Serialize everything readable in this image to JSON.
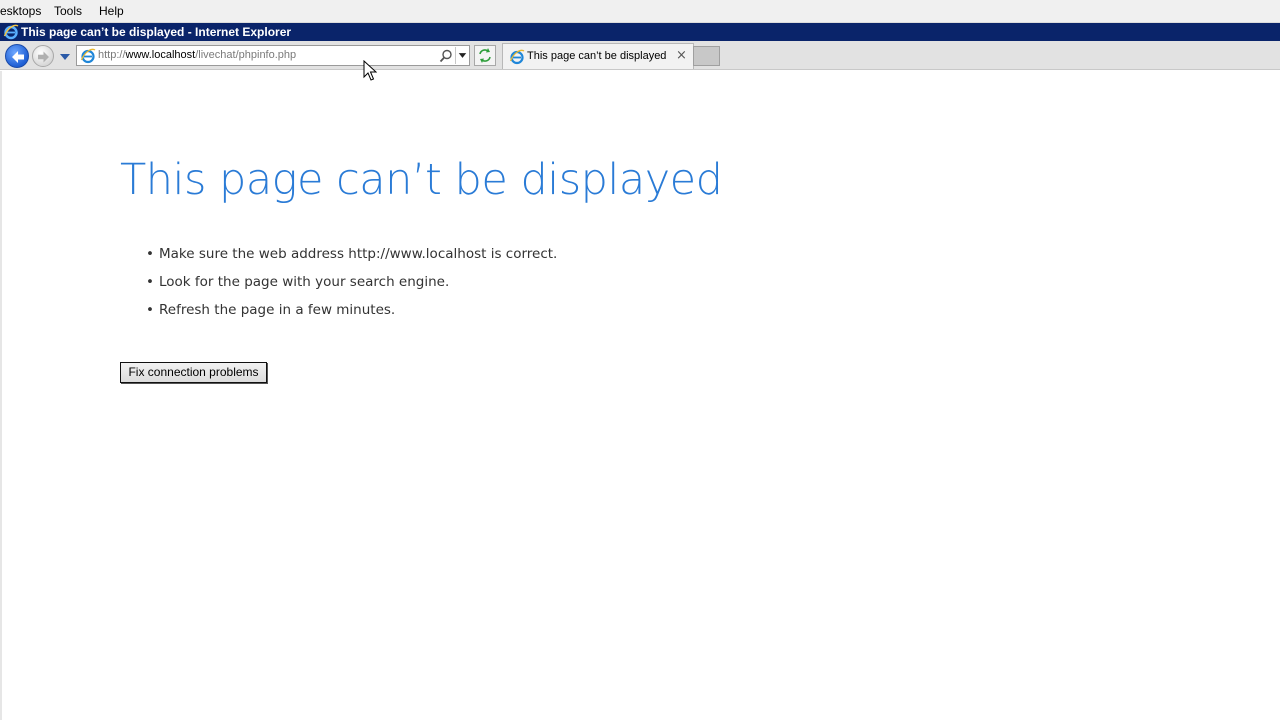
{
  "menubar": {
    "items": [
      "esktops",
      "Tools",
      "Help"
    ]
  },
  "window": {
    "title": "This page can’t be displayed - Internet Explorer"
  },
  "address_bar": {
    "url_prefix": "http://",
    "url_host": "www.localhost",
    "url_path": "/livechat/phpinfo.php"
  },
  "tab": {
    "label": "This page can’t be displayed",
    "close_glyph": "×"
  },
  "content": {
    "title": "This page can’t be displayed",
    "bullets": [
      "Make sure the web address http://www.localhost is correct.",
      "Look for the page with your search engine.",
      "Refresh the page in a few minutes."
    ],
    "bullet_glyph": "•",
    "fix_button_label": "Fix connection problems"
  },
  "icons": {
    "back": "back-arrow-icon",
    "forward": "forward-arrow-icon",
    "ie_logo": "ie-logo-icon",
    "search": "search-icon",
    "refresh": "refresh-icon",
    "cursor": "mouse-pointer-icon"
  },
  "colors": {
    "title_bar": "#0a246a",
    "error_title": "#2a7bd6",
    "back_button": "#1f5fd4"
  }
}
